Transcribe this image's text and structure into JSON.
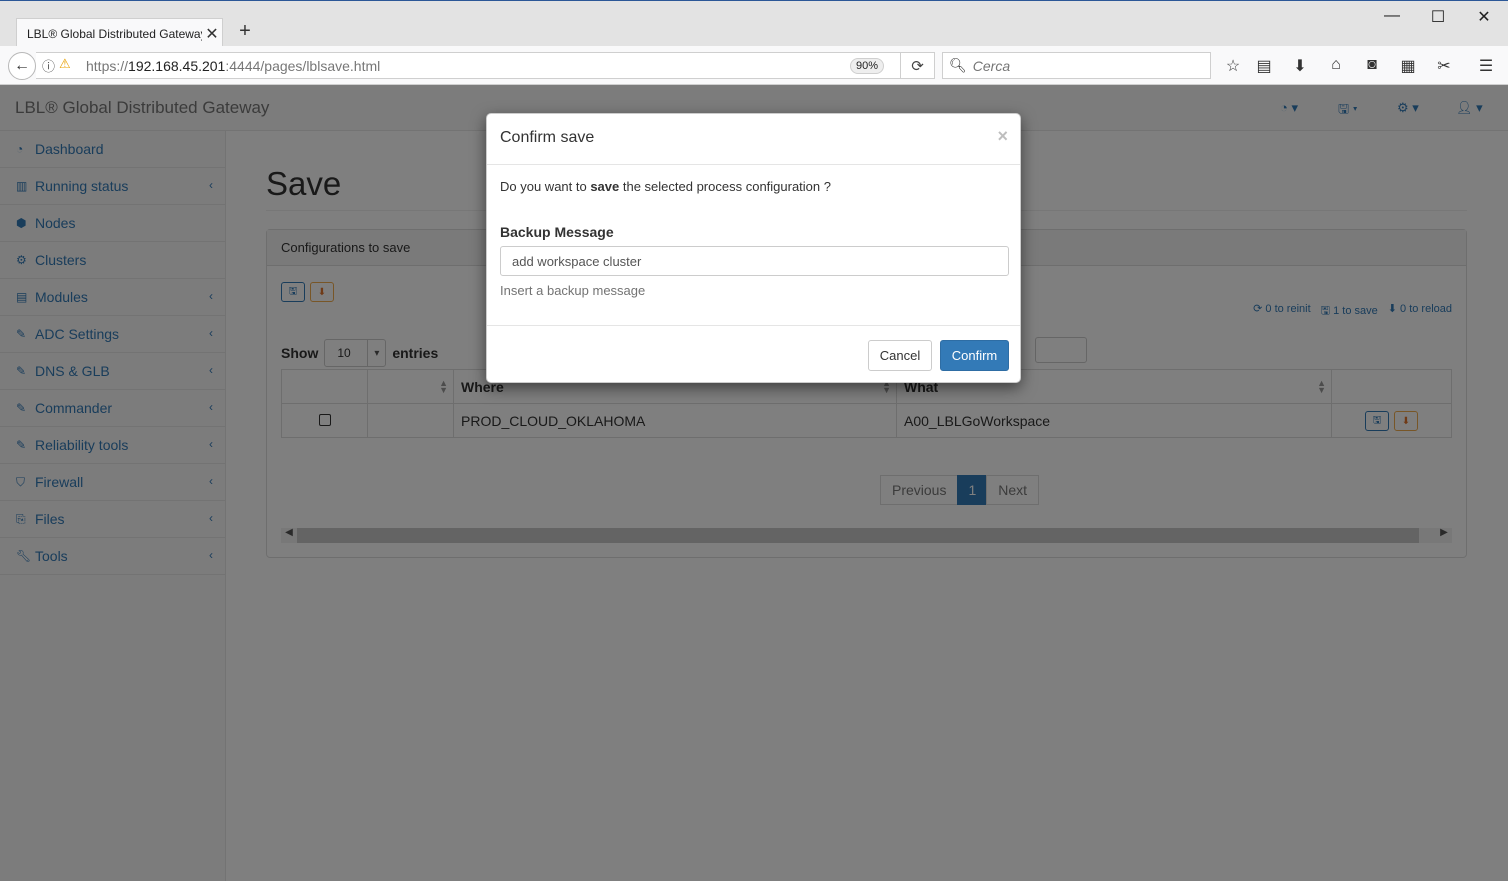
{
  "browser": {
    "tab_title": "LBL® Global Distributed Gateway",
    "url_prefix": "https://",
    "url_host": "192.168.45.201",
    "url_rest": ":4444/pages/lblsave.html",
    "zoom": "90%",
    "search_placeholder": "Cerca"
  },
  "app": {
    "brand": "LBL® Global Distributed Gateway"
  },
  "sidebar": {
    "items": [
      {
        "label": "Dashboard"
      },
      {
        "label": "Running status"
      },
      {
        "label": "Nodes"
      },
      {
        "label": "Clusters"
      },
      {
        "label": "Modules"
      },
      {
        "label": "ADC Settings"
      },
      {
        "label": "DNS & GLB"
      },
      {
        "label": "Commander"
      },
      {
        "label": "Reliability tools"
      },
      {
        "label": "Firewall"
      },
      {
        "label": "Files"
      },
      {
        "label": "Tools"
      }
    ]
  },
  "main": {
    "page_title": "Save",
    "panel_heading": "Configurations to save",
    "counters": {
      "reinit": "0 to reinit",
      "save": "1 to save",
      "reload": "0 to reload"
    },
    "show_label": "Show",
    "entries_value": "10",
    "entries_label": "entries",
    "columns": [
      "Where",
      "What"
    ],
    "rows": [
      {
        "where": "PROD_CLOUD_OKLAHOMA",
        "what": "A00_LBLGoWorkspace"
      }
    ],
    "pagination": {
      "previous": "Previous",
      "page": "1",
      "next": "Next"
    }
  },
  "modal": {
    "title": "Confirm save",
    "close": "×",
    "question_pre": "Do you want to ",
    "question_bold": "save",
    "question_post": " the selected process configuration ?",
    "field_label": "Backup Message",
    "input_value": "add workspace cluster",
    "help_text": "Insert a backup message",
    "cancel": "Cancel",
    "confirm": "Confirm"
  }
}
